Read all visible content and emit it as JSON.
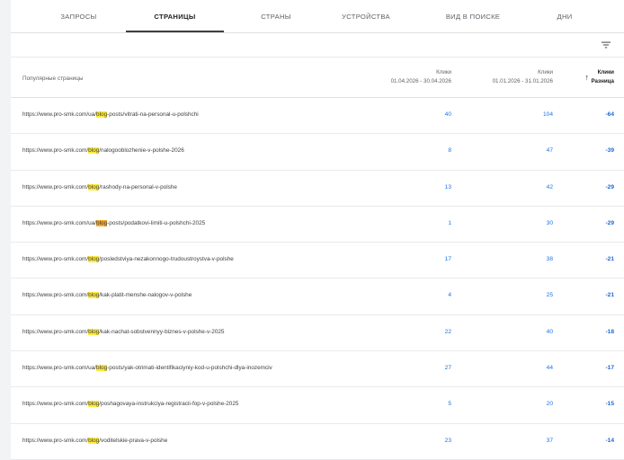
{
  "tabs": [
    "ЗАПРОСЫ",
    "СТРАНИЦЫ",
    "СТРАНЫ",
    "УСТРОЙСТВА",
    "ВИД В ПОИСКЕ",
    "ДНИ"
  ],
  "active_tab": "СТРАНИЦЫ",
  "table": {
    "label": "Популярные страницы",
    "col1_title": "Клики",
    "col1_dates": "01.04.2026 - 30.04.2026",
    "col2_title": "Клики",
    "col2_dates": "01.01.2026 - 31.01.2026",
    "col3_title": "Клики",
    "col3_sub": "Разница",
    "sort_icon": "arrow-up-icon",
    "filter_icon": "filter-icon",
    "rows": [
      {
        "prefix": "https://www.pro-smk.com/ua/",
        "hl": "blog",
        "suffix": "-posts/vitrati-na-personal-u-polshchi",
        "a": "40",
        "b": "104",
        "diff": "-64"
      },
      {
        "prefix": "https://www.pro-smk.com/",
        "hl": "blog",
        "suffix": "/nalogooblozhenie-v-polshe-2026",
        "a": "8",
        "b": "47",
        "diff": "-39"
      },
      {
        "prefix": "https://www.pro-smk.com/",
        "hl": "blog",
        "suffix": "/rashody-na-personal-v-polshe",
        "a": "13",
        "b": "42",
        "diff": "-29"
      },
      {
        "prefix": "https://www.pro-smk.com/ua/",
        "hl": "blog",
        "suffix": "-posts/podatkovi-limiti-u-polshchi-2025",
        "a": "1",
        "b": "30",
        "diff": "-29"
      },
      {
        "prefix": "https://www.pro-smk.com/",
        "hl": "blog",
        "suffix": "/posledstviya-nezakonnogo-trudoustroystva-v-polshe",
        "a": "17",
        "b": "38",
        "diff": "-21"
      },
      {
        "prefix": "https://www.pro-smk.com/",
        "hl": "blog",
        "suffix": "/kak-platit-menshe-nalogov-v-polshe",
        "a": "4",
        "b": "25",
        "diff": "-21"
      },
      {
        "prefix": "https://www.pro-smk.com/",
        "hl": "blog",
        "suffix": "/kak-nachat-sobstvennyy-biznes-v-polshe-v-2025",
        "a": "22",
        "b": "40",
        "diff": "-18"
      },
      {
        "prefix": "https://www.pro-smk.com/ua/",
        "hl": "blog",
        "suffix": "-posts/yak-otrimati-identifikaciyniy-kod-u-polshchi-dlya-inozemciv",
        "a": "27",
        "b": "44",
        "diff": "-17"
      },
      {
        "prefix": "https://www.pro-smk.com/",
        "hl": "blog",
        "suffix": "/poshagovaya-instrukciya-registracii-fop-v-polshe-2025",
        "a": "5",
        "b": "20",
        "diff": "-15"
      },
      {
        "prefix": "https://www.pro-smk.com/",
        "hl": "blog",
        "suffix": "/voditelskie-prava-v-polshe",
        "a": "23",
        "b": "37",
        "diff": "-14"
      }
    ]
  }
}
